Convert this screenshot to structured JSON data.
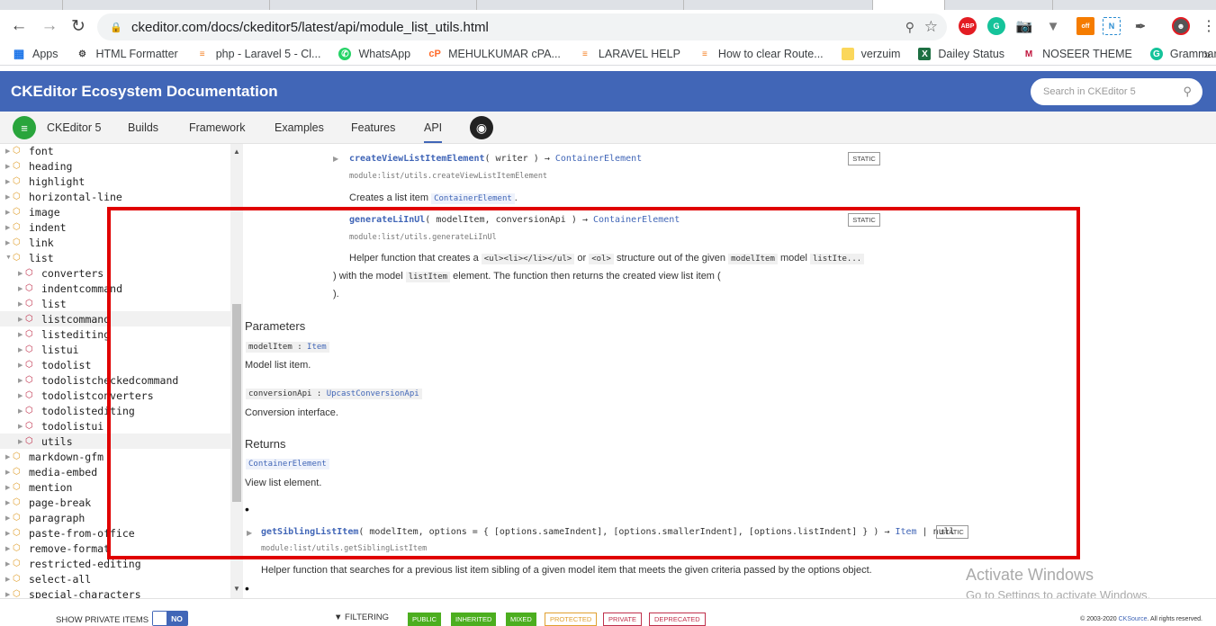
{
  "browser": {
    "url": "ckeditor.com/docs/ckeditor5/latest/api/module_list_utils.html",
    "bookmarks": [
      "Apps",
      "HTML Formatter",
      "php - Laravel 5 - Cl...",
      "WhatsApp",
      "MEHULKUMAR cPA...",
      "LARAVEL HELP",
      "How to clear Route...",
      "verzuim",
      "Dailey Status",
      "NOSEER THEME",
      "Grammarly TEST"
    ],
    "more": "»",
    "ext_badge": "off",
    "ext_abp": "ABP"
  },
  "site": {
    "title": "CKEditor Ecosystem Documentation",
    "search_placeholder": "Search in CKEditor 5",
    "nav": [
      "CKEditor 5",
      "Builds",
      "Framework",
      "Examples",
      "Features",
      "API"
    ]
  },
  "sidebar": {
    "items": [
      {
        "label": "font",
        "level": 0
      },
      {
        "label": "heading",
        "level": 0
      },
      {
        "label": "highlight",
        "level": 0
      },
      {
        "label": "horizontal-line",
        "level": 0
      },
      {
        "label": "image",
        "level": 0
      },
      {
        "label": "indent",
        "level": 0
      },
      {
        "label": "link",
        "level": 0
      },
      {
        "label": "list",
        "level": 0,
        "open": true
      },
      {
        "label": "converters",
        "level": 1
      },
      {
        "label": "indentcommand",
        "level": 1
      },
      {
        "label": "list",
        "level": 1
      },
      {
        "label": "listcommand",
        "level": 1,
        "hl": true
      },
      {
        "label": "listediting",
        "level": 1
      },
      {
        "label": "listui",
        "level": 1
      },
      {
        "label": "todolist",
        "level": 1
      },
      {
        "label": "todolistcheckedcommand",
        "level": 1
      },
      {
        "label": "todolistconverters",
        "level": 1
      },
      {
        "label": "todolistediting",
        "level": 1
      },
      {
        "label": "todolistui",
        "level": 1
      },
      {
        "label": "utils",
        "level": 1,
        "hl": true
      },
      {
        "label": "markdown-gfm",
        "level": 0
      },
      {
        "label": "media-embed",
        "level": 0
      },
      {
        "label": "mention",
        "level": 0
      },
      {
        "label": "page-break",
        "level": 0
      },
      {
        "label": "paragraph",
        "level": 0
      },
      {
        "label": "paste-from-office",
        "level": 0
      },
      {
        "label": "remove-format",
        "level": 0
      },
      {
        "label": "restricted-editing",
        "level": 0
      },
      {
        "label": "select-all",
        "level": 0
      },
      {
        "label": "special-characters",
        "level": 0
      }
    ],
    "private_label": "SHOW PRIVATE ITEMS",
    "private_value": "NO"
  },
  "content": {
    "m1": {
      "name": "createViewListItemElement",
      "args": "( writer )",
      "arrow": "→",
      "ret": "ContainerElement",
      "path": "module:list/utils.createViewListItemElement",
      "desc_pre": "Creates a list item",
      "desc_code": "ContainerElement",
      "desc_post": ".",
      "badge": "STATIC"
    },
    "m2": {
      "name": "generateLiInUl",
      "args": "( modelItem, conversionApi )",
      "arrow": "→",
      "ret": "ContainerElement",
      "path": "module:list/utils.generateLiInUl",
      "badge": "STATIC",
      "d1": "Helper function that creates a",
      "c1": "<ul><li></li></ul>",
      "d2": "or",
      "c2": "<ol>",
      "d3": "structure out of the given",
      "c3": "modelItem",
      "d4": "model",
      "c4": "listIte...",
      "l2a": ") with the model",
      "l2c": "listItem",
      "l2b": "element. The function then returns the created view list item (",
      "l3": ")."
    },
    "params_heading": "Parameters",
    "p1": {
      "name": "modelItem",
      "sep": ":",
      "type": "Item",
      "desc": "Model list item."
    },
    "p2": {
      "name": "conversionApi",
      "sep": ":",
      "type": "UpcastConversionApi",
      "desc": "Conversion interface."
    },
    "returns_heading": "Returns",
    "ret_type": "ContainerElement",
    "ret_desc": "View list element.",
    "bullet": "•",
    "m3": {
      "name": "getSiblingListItem",
      "args": "( modelItem, options = { [options.sameIndent], [options.smallerIndent], [options.listIndent] } )",
      "arrow": "→",
      "ret": "Item",
      "pipe": "|",
      "null": "null",
      "path": "module:list/utils.getSiblingListItem",
      "badge": "STATIC",
      "desc": "Helper function that searches for a previous list item sibling of a given model item that meets the given criteria passed by the options object."
    }
  },
  "watermark": {
    "line1": "Activate Windows",
    "line2": "Go to Settings to activate Windows."
  },
  "footer": {
    "filtering": "FILTERING",
    "badges": [
      {
        "label": "PUBLIC",
        "color": "#4cae1f",
        "filled": true
      },
      {
        "label": "INHERITED",
        "color": "#4cae1f",
        "filled": true
      },
      {
        "label": "MIXED",
        "color": "#4cae1f",
        "filled": true
      },
      {
        "label": "PROTECTED",
        "color": "#e0a030",
        "filled": false
      },
      {
        "label": "PRIVATE",
        "color": "#c0314c",
        "filled": false
      },
      {
        "label": "DEPRECATED",
        "color": "#c0314c",
        "filled": false
      }
    ],
    "copyright_pre": "© 2003-2020",
    "copyright_link": "CKSource",
    "copyright_post": ". All rights reserved."
  }
}
